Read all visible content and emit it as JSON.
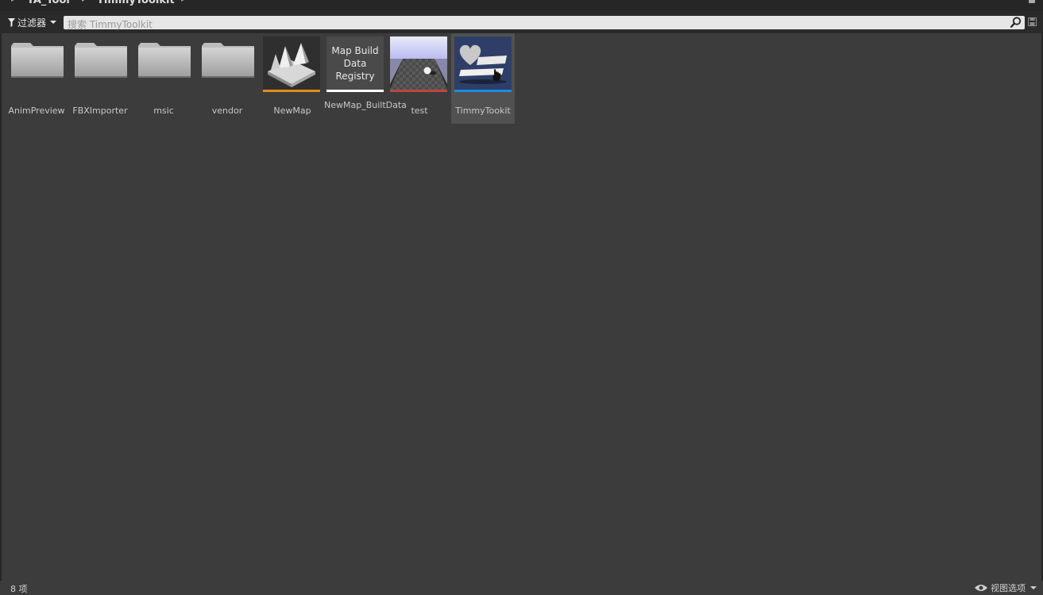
{
  "breadcrumb": {
    "items": [
      "TA_Tool",
      "TimmyToolkit"
    ]
  },
  "toolbar": {
    "filter_label": "过滤器",
    "search_placeholder": "搜索 TimmyToolkit"
  },
  "assets": [
    {
      "name": "AnimPreview",
      "kind": "folder"
    },
    {
      "name": "FBXImporter",
      "kind": "folder"
    },
    {
      "name": "msic",
      "kind": "folder"
    },
    {
      "name": "vendor",
      "kind": "folder"
    },
    {
      "name": "NewMap",
      "kind": "map",
      "color": "#e48a1c"
    },
    {
      "name": "NewMap_BuiltData",
      "kind": "registry",
      "color": "#ffffff",
      "thumb_text": [
        "Map Build",
        "Data",
        "Registry"
      ]
    },
    {
      "name": "test",
      "kind": "material",
      "color": "#c0463c"
    },
    {
      "name": "TimmyTookit",
      "kind": "widget",
      "color": "#1a8ce6",
      "selected": true
    }
  ],
  "status": {
    "item_count": "8 项",
    "view_options": "视图选项"
  },
  "colors": {
    "panel_bg": "#3c3c3c",
    "toolbar_bg": "#2a2a2a",
    "selection_bg": "#515151"
  }
}
